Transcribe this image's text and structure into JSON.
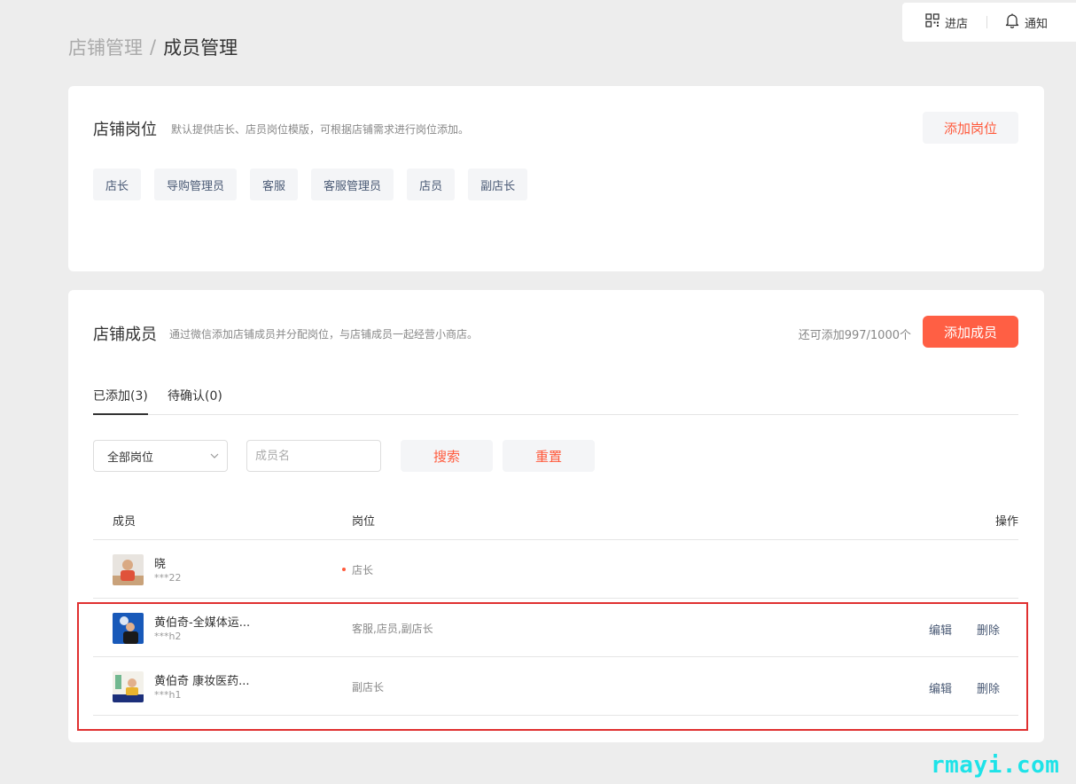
{
  "header": {
    "enter_label": "进店",
    "notify_label": "通知"
  },
  "breadcrumb": {
    "parent": "店铺管理",
    "separator": "/",
    "current": "成员管理"
  },
  "positions": {
    "title": "店铺岗位",
    "description": "默认提供店长、店员岗位模版，可根据店铺需求进行岗位添加。",
    "add_button": "添加岗位",
    "tags": [
      "店长",
      "导购管理员",
      "客服",
      "客服管理员",
      "店员",
      "副店长"
    ]
  },
  "members": {
    "title": "店铺成员",
    "description": "通过微信添加店铺成员并分配岗位，与店铺成员一起经营小商店。",
    "quota": "还可添加997/1000个",
    "add_button": "添加成员",
    "tabs": {
      "added": "已添加(3)",
      "pending": "待确认(0)"
    },
    "filter": {
      "select_value": "全部岗位",
      "name_placeholder": "成员名",
      "search": "搜索",
      "reset": "重置"
    },
    "columns": {
      "member": "成员",
      "role": "岗位",
      "ops": "操作"
    },
    "rows": [
      {
        "name": "晓",
        "id": "***22",
        "role": "店长",
        "edit": "",
        "delete": ""
      },
      {
        "name": "黄伯奇-全媒体运...",
        "id": "***h2",
        "role": "客服,店员,副店长",
        "edit": "编辑",
        "delete": "删除"
      },
      {
        "name": "黄伯奇 康妆医药...",
        "id": "***h1",
        "role": "副店长",
        "edit": "编辑",
        "delete": "删除"
      }
    ]
  },
  "watermark": "rmayi.com",
  "colors": {
    "accent": "#ff5f44",
    "highlight": "#e03030",
    "link": "#4a5a75"
  }
}
